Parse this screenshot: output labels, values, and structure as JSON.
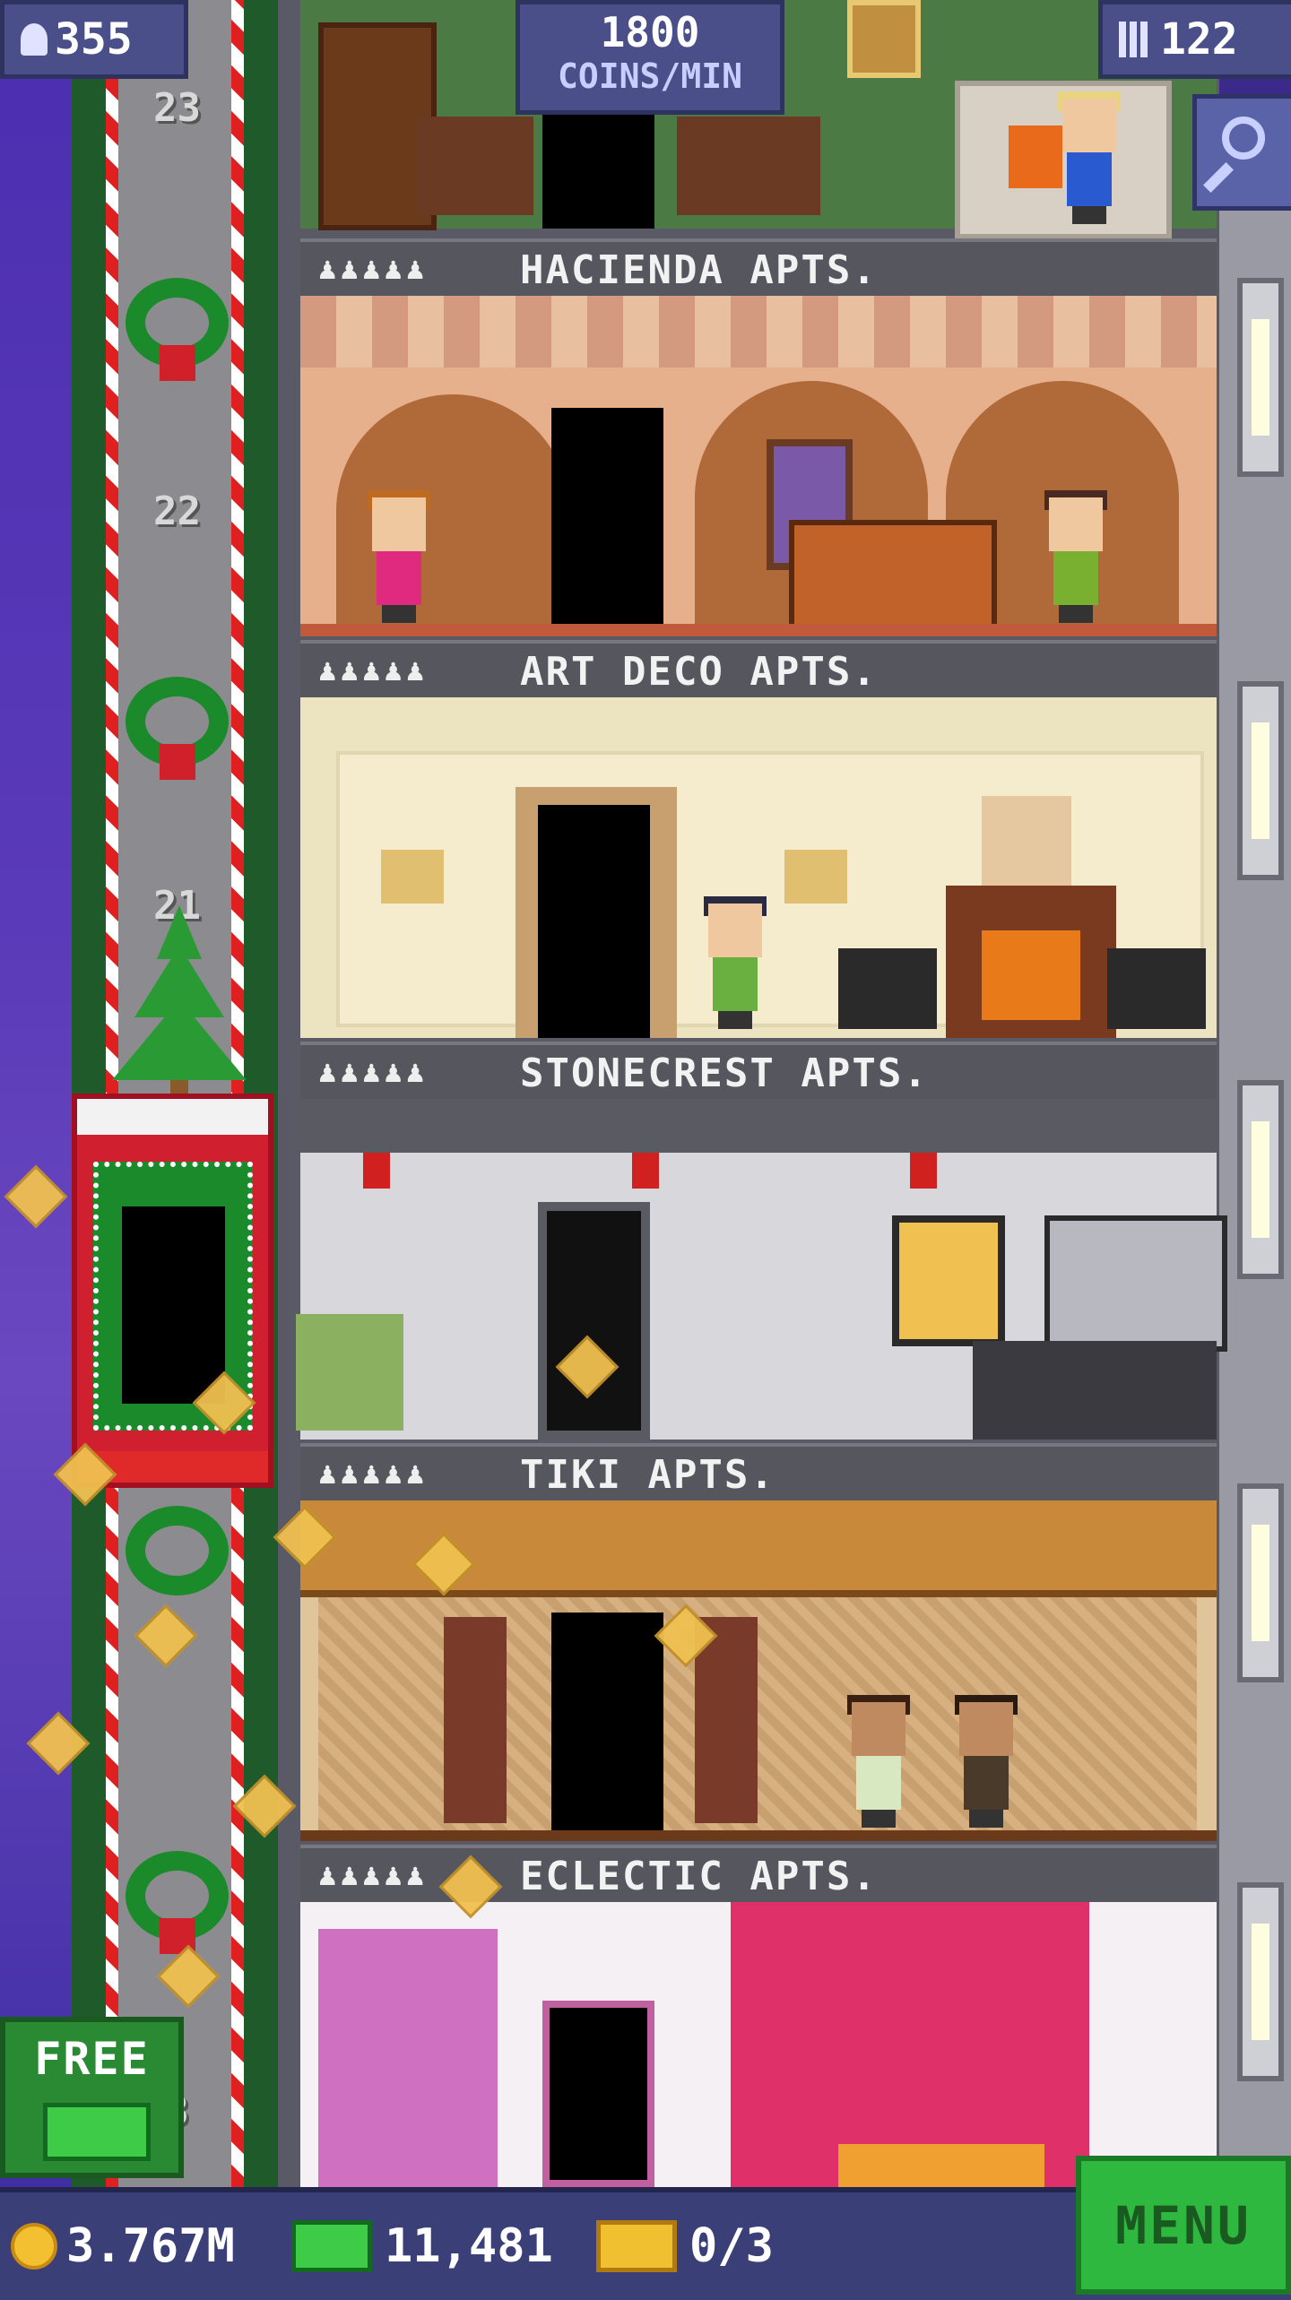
{
  "hud": {
    "population": "355",
    "coins_per_min_value": "1800",
    "coins_per_min_unit": "COINS/MIN",
    "floors": "122"
  },
  "elevator": {
    "floor_numbers": [
      "23",
      "22",
      "21",
      "8"
    ]
  },
  "floors": [
    {
      "name": "HACIENDA APTS.",
      "occupancy_icons": "♟♟♟♟♟"
    },
    {
      "name": "ART DECO APTS.",
      "occupancy_icons": "♟♟♟♟♟"
    },
    {
      "name": "STONECREST APTS.",
      "occupancy_icons": "♟♟♟♟♟"
    },
    {
      "name": "TIKI APTS.",
      "occupancy_icons": "♟♟♟♟♟"
    },
    {
      "name": "ECLECTIC APTS.",
      "occupancy_icons": "♟♟♟♟♟"
    }
  ],
  "free_button": {
    "label": "FREE"
  },
  "bottom_bar": {
    "coins": "3.767M",
    "bux": "11,481",
    "tickets": "0/3",
    "menu_label": "MENU"
  },
  "colors": {
    "shaft_green": "#1f5a2a",
    "candy_red": "#e02020",
    "hud_blue": "#4a4f8a",
    "menu_green": "#2fb840",
    "coin_gold": "#f2c030"
  },
  "icons": [
    "person-icon",
    "floors-icon",
    "zoom-out-icon",
    "coin-icon",
    "bux-icon",
    "ticket-icon",
    "wreath-icon",
    "christmas-tree-icon"
  ]
}
